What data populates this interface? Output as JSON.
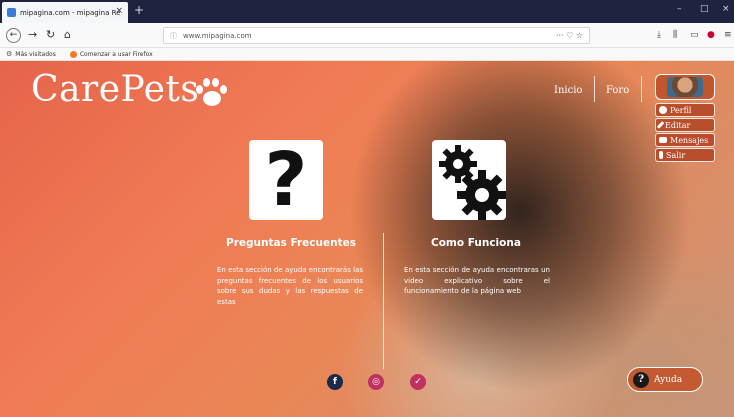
{
  "browser": {
    "tab_title": "mipagina.com - mipagina Rec",
    "tab_close": "×",
    "new_tab": "+",
    "url": "www.mipagina.com",
    "url_icons": "··· ♡ ☆",
    "win_min": "–",
    "win_max": "□",
    "win_close": "×",
    "bookmarks": [
      "Más visitados",
      "Comenzar a usar Firefox"
    ]
  },
  "site": {
    "logo": "CarePets",
    "nav": [
      "Inicio",
      "Foro"
    ],
    "user_menu": [
      "Perfil",
      "Editar",
      "Mensajes",
      "Salir"
    ],
    "cards": [
      {
        "title": "Preguntas Frecuentes",
        "text": "En esta sección de ayuda encontrarás las preguntas frecuentes de los usuarios sobre sus dudas y las respuestas de estas",
        "icon": "question-mark-icon"
      },
      {
        "title": "Como Funciona",
        "text": "En esta sección de ayuda encontraras un video explicativo sobre el funcionamiento de la página web",
        "icon": "gears-icon"
      }
    ],
    "social": [
      "facebook-icon",
      "instagram-icon",
      "twitter-icon"
    ],
    "help_label": "Ayuda"
  },
  "colors": {
    "accent": "#c45a32",
    "facebook": "#1b2a4a",
    "instagram": "#c03060",
    "twitter": "#c03060"
  }
}
